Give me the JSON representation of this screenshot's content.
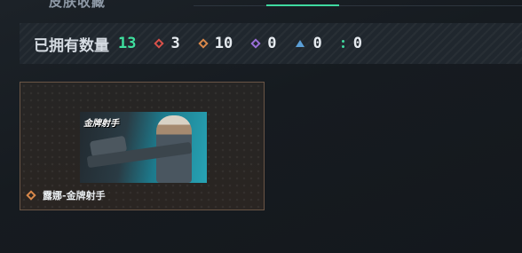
{
  "header": {
    "cut_title": "皮肤收藏",
    "active_tab_color": "#3fd9a0"
  },
  "stats": {
    "owned_label": "已拥有数量",
    "owned_count": "13",
    "rarities": [
      {
        "icon": "red-diamond-icon",
        "color": "#d9514a",
        "count": "3"
      },
      {
        "icon": "orange-diamond-icon",
        "color": "#d9884a",
        "count": "10"
      },
      {
        "icon": "purple-diamond-icon",
        "color": "#9a6fd9",
        "count": "0"
      },
      {
        "icon": "blue-triangle-icon",
        "color": "#5b9fd6",
        "count": "0"
      },
      {
        "icon": "green-dots-icon",
        "color": "#3fd9a0",
        "count": "0"
      }
    ]
  },
  "items": [
    {
      "name": "露娜-金牌射手",
      "image_logo": "金牌射手",
      "rarity_icon": "orange-diamond-icon",
      "rarity_color": "#d9884a"
    }
  ]
}
